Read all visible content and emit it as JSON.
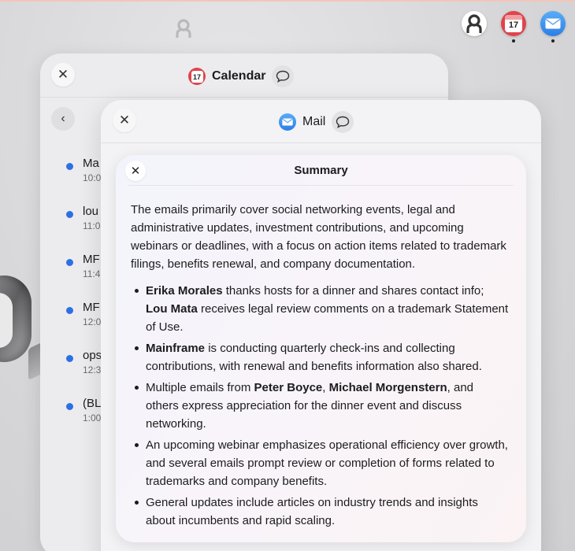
{
  "colors": {
    "accent_blue": "#2f6fe4",
    "calendar_red": "#e0444b",
    "mail_blue": "#3a8ff0"
  },
  "dock": {
    "items": [
      {
        "name": "contacts-dock-icon"
      },
      {
        "name": "calendar-dock-icon",
        "date": "17"
      },
      {
        "name": "mail-dock-icon"
      }
    ]
  },
  "calendar_window": {
    "title": "Calendar",
    "icon_date": "17",
    "events": [
      {
        "title": "Ma",
        "time": "10:0"
      },
      {
        "title": "lou",
        "time": "11:0"
      },
      {
        "title": "MF",
        "time": "11:4"
      },
      {
        "title": "MF",
        "time": "12:0"
      },
      {
        "title": "ops",
        "time": "12:3"
      },
      {
        "title": "(BL",
        "time": "1:00"
      }
    ]
  },
  "mail_window": {
    "title": "Mail"
  },
  "summary": {
    "title": "Summary",
    "intro": "The emails primarily cover social networking events, legal and administrative updates, investment contributions, and upcoming webinars or deadlines, with a focus on action items related to trademark filings, benefits renewal, and company documentation.",
    "bullets": [
      {
        "b1_name1": "Erika Morales",
        "b1_text1": " thanks hosts for a dinner and shares contact info; ",
        "b1_name2": "Lou Mata",
        "b1_text2": " receives legal review comments on a trademark Statement of Use."
      },
      {
        "b2_name1": "Mainframe",
        "b2_text1": " is conducting quarterly check-ins and collecting contributions, with renewal and benefits information also shared."
      },
      {
        "b3_text0": "Multiple emails from ",
        "b3_name1": "Peter Boyce",
        "b3_sep": ", ",
        "b3_name2": "Michael Morgenstern",
        "b3_text1": ", and others express appreciation for the dinner event and discuss networking."
      },
      {
        "b4_text": "An upcoming webinar emphasizes operational efficiency over growth, and several emails prompt review or completion of forms related to trademarks and company benefits."
      },
      {
        "b5_text": "General updates include articles on industry trends and insights about incumbents and rapid scaling."
      }
    ]
  }
}
